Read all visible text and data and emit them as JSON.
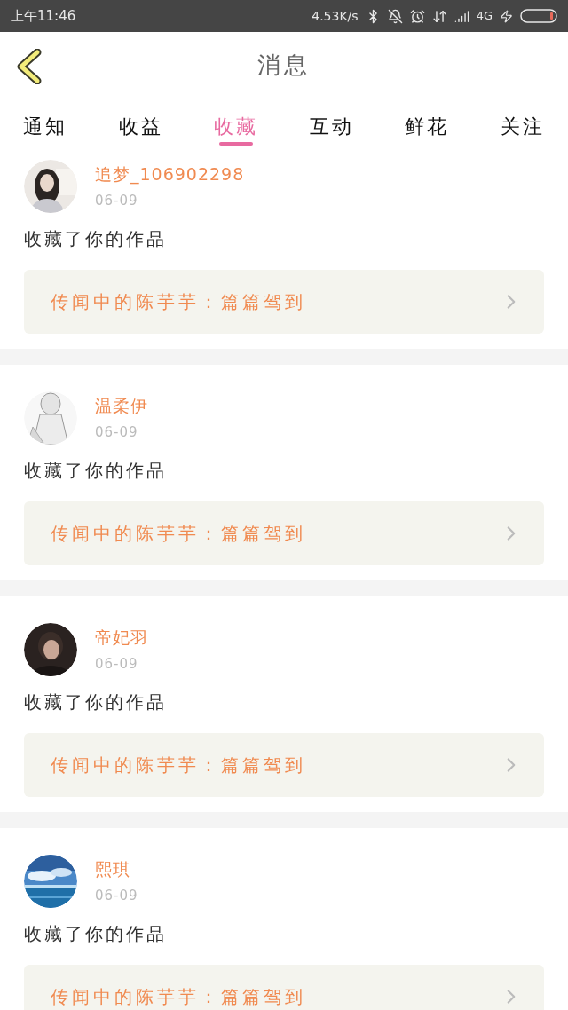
{
  "status_bar": {
    "time": "上午11:46",
    "speed": "4.53K/s",
    "network": "4G"
  },
  "header": {
    "title": "消息"
  },
  "tabs": [
    {
      "label": "通知",
      "selected": false
    },
    {
      "label": "收益",
      "selected": false
    },
    {
      "label": "收藏",
      "selected": true
    },
    {
      "label": "互动",
      "selected": false
    },
    {
      "label": "鲜花",
      "selected": false
    },
    {
      "label": "关注",
      "selected": false
    }
  ],
  "messages": [
    {
      "user": "追梦_106902298",
      "date": "06-09",
      "action": "收藏了你的作品",
      "work": "传闻中的陈芋芋：篇篇驾到"
    },
    {
      "user": "温柔伊",
      "date": "06-09",
      "action": "收藏了你的作品",
      "work": "传闻中的陈芋芋：篇篇驾到"
    },
    {
      "user": "帝妃羽",
      "date": "06-09",
      "action": "收藏了你的作品",
      "work": "传闻中的陈芋芋：篇篇驾到"
    },
    {
      "user": "熙琪",
      "date": "06-09",
      "action": "收藏了你的作品",
      "work": "传闻中的陈芋芋：篇篇驾到"
    }
  ]
}
